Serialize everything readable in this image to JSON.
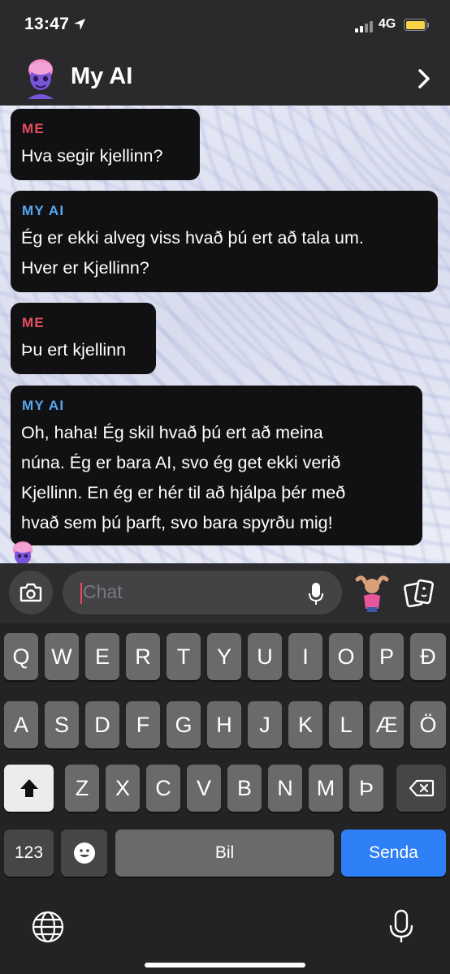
{
  "status_bar": {
    "time": "13:47",
    "network": "4G"
  },
  "header": {
    "title": "My AI"
  },
  "messages": [
    {
      "sender": "ME",
      "text_lines": [
        "Hva segir kjellinn?"
      ]
    },
    {
      "sender": "MY AI",
      "text_lines": [
        "Ég er ekki alveg viss hvað þú ert að tala um.",
        "Hver er Kjellinn?"
      ]
    },
    {
      "sender": "ME",
      "text_lines": [
        "Þu ert kjellinn"
      ]
    },
    {
      "sender": "MY AI",
      "text_lines": [
        "Oh, haha! Ég skil hvað þú ert að meina",
        "núna. Ég er bara AI, svo ég get ekki verið",
        "Kjellinn. En ég er hér til að hjálpa þér með",
        "hvað sem þú þarft, svo bara spyrðu mig!"
      ]
    }
  ],
  "composer": {
    "placeholder": "Chat"
  },
  "keyboard": {
    "row1": [
      "Q",
      "W",
      "E",
      "R",
      "T",
      "Y",
      "U",
      "I",
      "O",
      "P",
      "Đ"
    ],
    "row2": [
      "A",
      "S",
      "D",
      "F",
      "G",
      "H",
      "J",
      "K",
      "L",
      "Æ",
      "Ö"
    ],
    "row3": [
      "Z",
      "X",
      "C",
      "V",
      "B",
      "N",
      "M",
      "Þ"
    ],
    "numbers_label": "123",
    "space_label": "Bil",
    "send_label": "Senda"
  },
  "colors": {
    "me_label": "#e84d5d",
    "ai_label": "#58a8f2",
    "send_key": "#2f7ff6",
    "battery": "#f7d34a"
  },
  "icons": [
    "location-arrow-icon",
    "signal-icon",
    "battery-icon",
    "ai-avatar-icon",
    "chevron-right-icon",
    "camera-icon",
    "microphone-icon",
    "bitmoji-icon",
    "cards-icon",
    "emoji-icon",
    "shift-icon",
    "backspace-icon",
    "globe-icon"
  ]
}
